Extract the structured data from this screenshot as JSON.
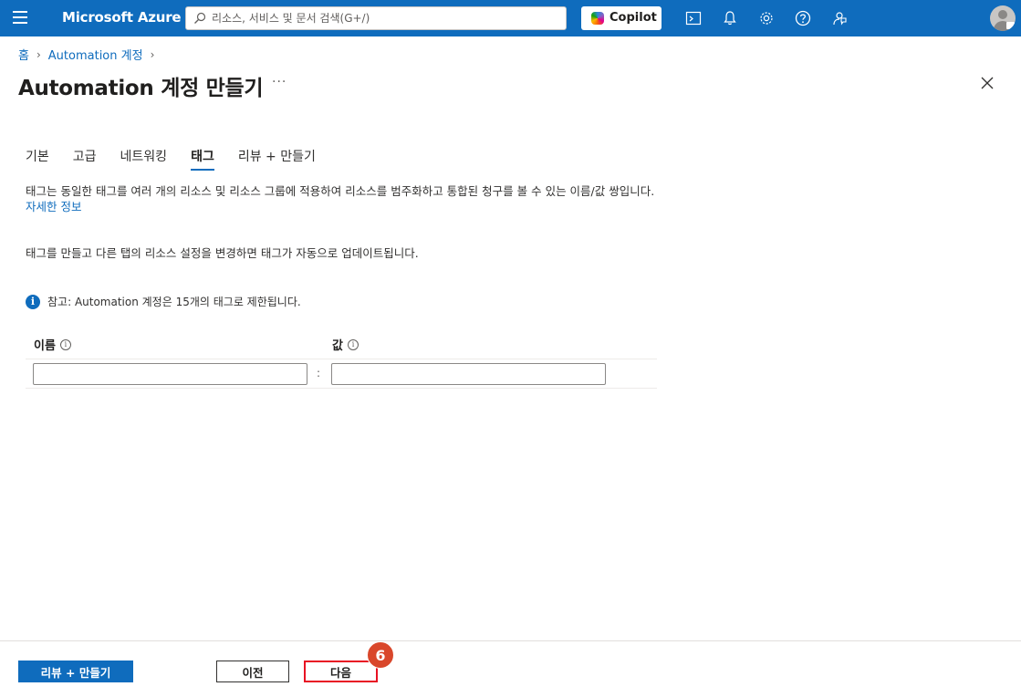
{
  "topbar": {
    "brand": "Microsoft Azure",
    "search_placeholder": "리소스, 서비스 및 문서 검색(G+/)",
    "copilot_label": "Copilot",
    "icons": [
      "cloud-shell-icon",
      "bell-icon",
      "gear-icon",
      "help-icon",
      "feedback-icon"
    ],
    "accent": "#0f6cbd"
  },
  "breadcrumb": {
    "home": "홈",
    "current": "Automation 계정"
  },
  "page": {
    "title": "Automation 계정 만들기",
    "more": "···"
  },
  "tabs": [
    {
      "label": "기본",
      "active": false
    },
    {
      "label": "고급",
      "active": false
    },
    {
      "label": "네트워킹",
      "active": false
    },
    {
      "label": "태그",
      "active": true
    },
    {
      "label": "리뷰 + 만들기",
      "active": false
    }
  ],
  "content": {
    "description": "태그는 동일한 태그를 여러 개의 리소스 및 리소스 그룹에 적용하여 리소스를 범주화하고 통합된 청구를 볼 수 있는 이름/값 쌍입니다.",
    "learn_more": "자세한 정보",
    "description2": "태그를 만들고 다른 탭의 리소스 설정을 변경하면 태그가 자동으로 업데이트됩니다.",
    "note": "참고: Automation 계정은 15개의 태그로 제한됩니다."
  },
  "table": {
    "name_header": "이름",
    "value_header": "값",
    "separator": ":",
    "name_value": "",
    "value_value": ""
  },
  "footer": {
    "review_create": "리뷰 + 만들기",
    "previous": "이전",
    "next": "다음",
    "step_badge": "6"
  }
}
